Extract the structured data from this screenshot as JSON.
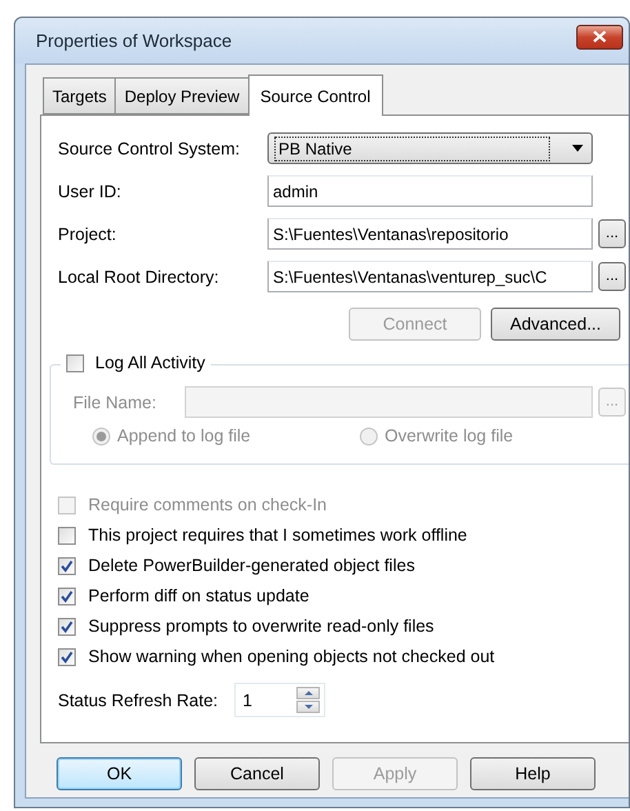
{
  "window": {
    "title": "Properties of Workspace"
  },
  "tabs": [
    {
      "label": "Targets",
      "selected": false
    },
    {
      "label": "Deploy Preview",
      "selected": false
    },
    {
      "label": "Source Control",
      "selected": true
    }
  ],
  "fields": [
    {
      "kind": "dropdown",
      "label": "Source Control System:",
      "value": "PB Native"
    },
    {
      "kind": "text",
      "label": "User ID:",
      "value": "admin"
    },
    {
      "kind": "browse",
      "label": "Project:",
      "value": "S:\\Fuentes\\Ventanas\\repositorio",
      "browse": "..."
    },
    {
      "kind": "browse",
      "label": "Local Root Directory:",
      "value": "S:\\Fuentes\\Ventanas\\venturep_suc\\C",
      "browse": "..."
    }
  ],
  "actions": [
    {
      "label": "Connect",
      "disabled": true
    },
    {
      "label": "Advanced...",
      "disabled": false
    }
  ],
  "log_group": {
    "label": "Log All Activity",
    "checked": false,
    "disabled": true,
    "file_label": "File Name:",
    "browse": "...",
    "modes": [
      {
        "label": "Append to log file",
        "selected": true
      },
      {
        "label": "Overwrite log file",
        "selected": false
      }
    ]
  },
  "options": [
    {
      "label": "Require comments on check-In",
      "checked": false,
      "disabled": true
    },
    {
      "label": "This project requires that I sometimes work offline",
      "checked": false,
      "disabled": false
    },
    {
      "label": "Delete PowerBuilder-generated object files",
      "checked": true,
      "disabled": false
    },
    {
      "label": "Perform diff on status update",
      "checked": true,
      "disabled": false
    },
    {
      "label": "Suppress prompts to overwrite read-only files",
      "checked": true,
      "disabled": false
    },
    {
      "label": "Show warning when opening objects not checked out",
      "checked": true,
      "disabled": false
    }
  ],
  "refresh_rate": {
    "label": "Status Refresh Rate:",
    "value": "1"
  },
  "buttons": [
    {
      "label": "OK",
      "default": true,
      "disabled": false
    },
    {
      "label": "Cancel",
      "default": false,
      "disabled": false
    },
    {
      "label": "Apply",
      "default": false,
      "disabled": true
    },
    {
      "label": "Help",
      "default": false,
      "disabled": false
    }
  ]
}
